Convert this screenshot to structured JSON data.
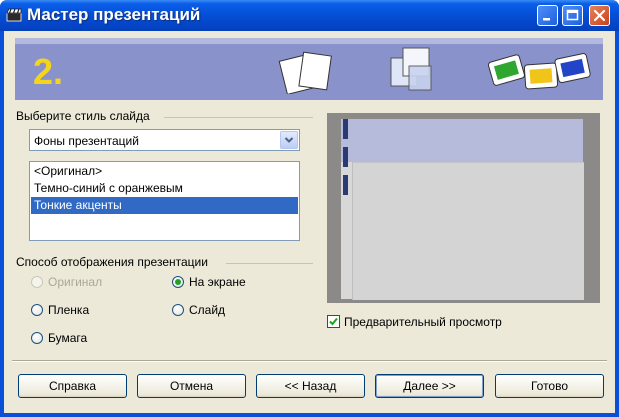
{
  "window": {
    "title": "Мастер презентаций"
  },
  "banner": {
    "step": "2."
  },
  "style_group": {
    "label": "Выберите стиль слайда",
    "dropdown_value": "Фоны презентаций",
    "list_items": [
      {
        "label": "<Оригинал>",
        "selected": false
      },
      {
        "label": "Темно-синий с оранжевым",
        "selected": false
      },
      {
        "label": "Тонкие акценты",
        "selected": true
      }
    ]
  },
  "output_group": {
    "label": "Способ отображения презентации",
    "options": {
      "original": {
        "label": "Оригинал",
        "checked": false,
        "disabled": true
      },
      "screen": {
        "label": "На экране",
        "checked": true,
        "disabled": false
      },
      "film": {
        "label": "Пленка",
        "checked": false,
        "disabled": false
      },
      "slide": {
        "label": "Слайд",
        "checked": false,
        "disabled": false
      },
      "paper": {
        "label": "Бумага",
        "checked": false,
        "disabled": false
      }
    }
  },
  "preview": {
    "checkbox_label": "Предварительный просмотр",
    "checked": true
  },
  "buttons": {
    "help": "Справка",
    "cancel": "Отмена",
    "back": "<< Назад",
    "next": "Далее >>",
    "done": "Готово"
  },
  "colors": {
    "titlebar": "#0650d8",
    "banner": "#8a92cc",
    "selection": "#316ac5",
    "step_number": "#f5d51a"
  }
}
